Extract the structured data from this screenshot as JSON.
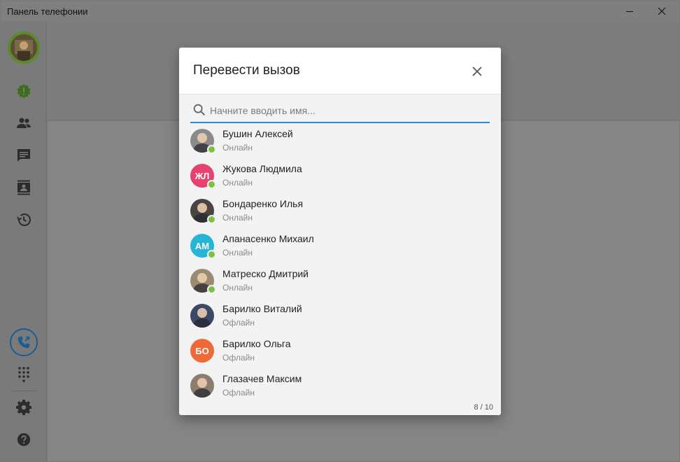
{
  "window": {
    "title": "Панель телефонии"
  },
  "colors": {
    "accent": "#2b8bd6",
    "online": "#7cc142",
    "transfer": "#1a5e90"
  },
  "sidebar": {
    "items": [
      {
        "icon": "alert-badge-icon"
      },
      {
        "icon": "people-icon"
      },
      {
        "icon": "chat-icon"
      },
      {
        "icon": "contacts-book-icon"
      },
      {
        "icon": "history-icon"
      },
      {
        "icon": "transfer-call-icon"
      },
      {
        "icon": "dialpad-icon"
      },
      {
        "icon": "gear-icon"
      },
      {
        "icon": "help-icon"
      }
    ]
  },
  "dialog": {
    "title": "Перевести вызов",
    "search_placeholder": "Начните вводить имя...",
    "counter": "8 / 10",
    "contacts": [
      {
        "name": "Бушин Алексей",
        "status": "Онлайн",
        "initials": "",
        "avatar_color": "#8a8a8a",
        "online": true
      },
      {
        "name": "Жукова Людмила",
        "status": "Онлайн",
        "initials": "ЖЛ",
        "avatar_color": "#e8406f",
        "online": true
      },
      {
        "name": "Бондаренко Илья",
        "status": "Онлайн",
        "initials": "",
        "avatar_color": "#4a4440",
        "online": true
      },
      {
        "name": "Апанасенко Михаил",
        "status": "Онлайн",
        "initials": "АМ",
        "avatar_color": "#26b5d6",
        "online": true
      },
      {
        "name": "Матреско Дмитрий",
        "status": "Онлайн",
        "initials": "",
        "avatar_color": "#9a8a70",
        "online": true
      },
      {
        "name": "Барилко Виталий",
        "status": "Офлайн",
        "initials": "",
        "avatar_color": "#3a4a66",
        "online": false
      },
      {
        "name": "Барилко Ольга",
        "status": "Офлайн",
        "initials": "БО",
        "avatar_color": "#f06a38",
        "online": false
      },
      {
        "name": "Глазачев Максим",
        "status": "Офлайн",
        "initials": "",
        "avatar_color": "#8c7d6e",
        "online": false
      }
    ]
  }
}
